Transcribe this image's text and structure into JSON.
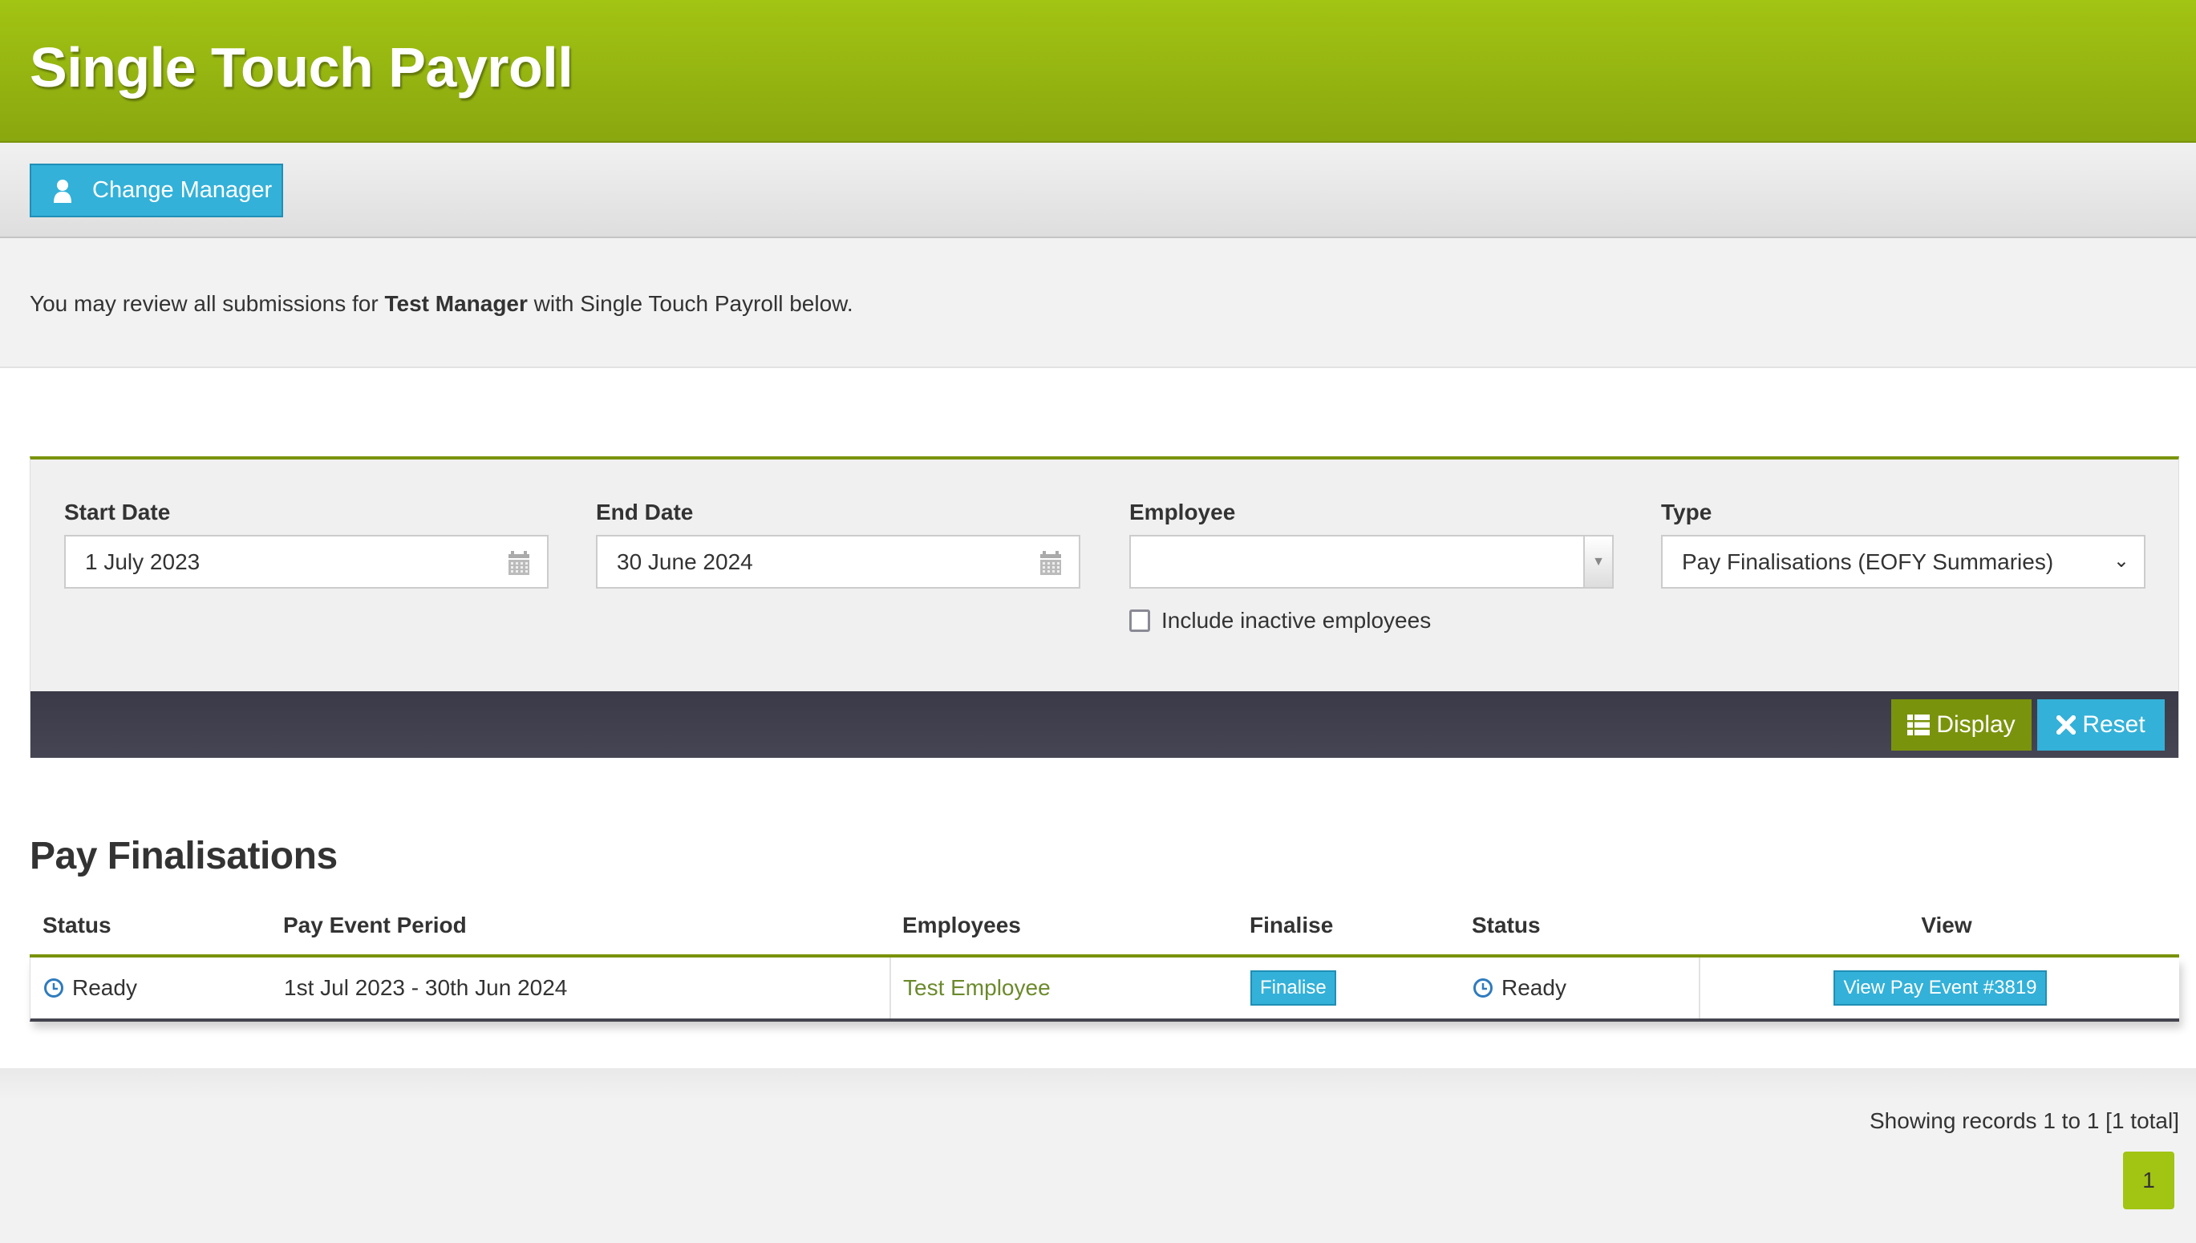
{
  "header": {
    "title": "Single Touch Payroll"
  },
  "toolbar": {
    "change_manager_label": "Change Manager",
    "change_manager_icon": "user-icon"
  },
  "description": {
    "prefix": "You may review all submissions for ",
    "manager": "Test Manager",
    "suffix": " with Single Touch Payroll below."
  },
  "filters": {
    "start_date": {
      "label": "Start Date",
      "value": "1 July 2023",
      "icon": "calendar-icon"
    },
    "end_date": {
      "label": "End Date",
      "value": "30 June 2024",
      "icon": "calendar-icon"
    },
    "employee": {
      "label": "Employee",
      "value": ""
    },
    "include_inactive": {
      "label": "Include inactive employees",
      "checked": false
    },
    "type": {
      "label": "Type",
      "value": "Pay Finalisations (EOFY Summaries)"
    },
    "display_label": "Display",
    "reset_label": "Reset"
  },
  "section": {
    "title": "Pay Finalisations"
  },
  "table": {
    "columns": [
      "Status",
      "Pay Event Period",
      "Employees",
      "Finalise",
      "Status",
      "View"
    ],
    "rows": [
      {
        "status": "Ready",
        "period": "1st Jul 2023 - 30th Jun 2024",
        "employees": "Test Employee",
        "finalise_label": "Finalise",
        "status2": "Ready",
        "view_label": "View Pay Event #3819"
      }
    ]
  },
  "pagination": {
    "summary": "Showing records 1 to 1 [1 total]",
    "current_page": "1"
  },
  "colors": {
    "brand_green": "#a2c413",
    "dark_green": "#7a930c",
    "accent_blue": "#33b1d9",
    "dark_bar": "#3e3e4c"
  }
}
